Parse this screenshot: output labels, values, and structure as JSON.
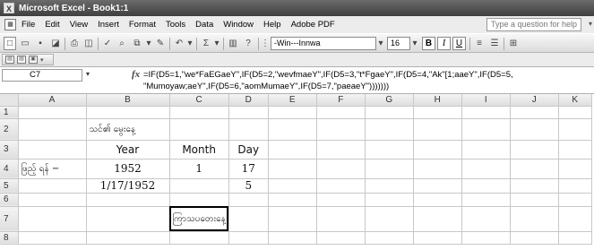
{
  "window": {
    "title": "Microsoft Excel - Book1:1",
    "app_icon": "X"
  },
  "menu": {
    "items": [
      "File",
      "Edit",
      "View",
      "Insert",
      "Format",
      "Tools",
      "Data",
      "Window",
      "Help",
      "Adobe PDF"
    ],
    "question_placeholder": "Type a question for help"
  },
  "toolbar": {
    "font_name": "-Win---Innwa",
    "font_size": "16",
    "bold": "B",
    "italic": "I",
    "underline": "U"
  },
  "formula_bar": {
    "cell_ref": "C7",
    "fx": "fx",
    "formula": "=IF(D5=1,\"we*FaEGaeY\",IF(D5=2,\"wevfmaeY\",IF(D5=3,\"t*FgaeY\",IF(D5=4,\"Ak\"[1;aaeY\",IF(D5=5,\n\"Mumoyaw;aeY\",IF(D5=6,\"aomMumaeY\",IF(D5=7,\"paeaeY\")))))))"
  },
  "sheet": {
    "columns": [
      "A",
      "B",
      "C",
      "D",
      "E",
      "F",
      "G",
      "H",
      "I",
      "J",
      "K"
    ],
    "rows": [
      "1",
      "2",
      "3",
      "4",
      "5",
      "6",
      "7",
      "8"
    ],
    "cells": {
      "A4": "ဖြည့် ရန် −",
      "B2": "သင်၏ မွေးနေ့",
      "B3": "Year",
      "C3": "Month",
      "D3": "Day",
      "B4": "1952",
      "C4": "1",
      "D4": "17",
      "B5": "1/17/1952",
      "D5": "5",
      "C7": "ကြာသပတေးနေ့"
    }
  }
}
